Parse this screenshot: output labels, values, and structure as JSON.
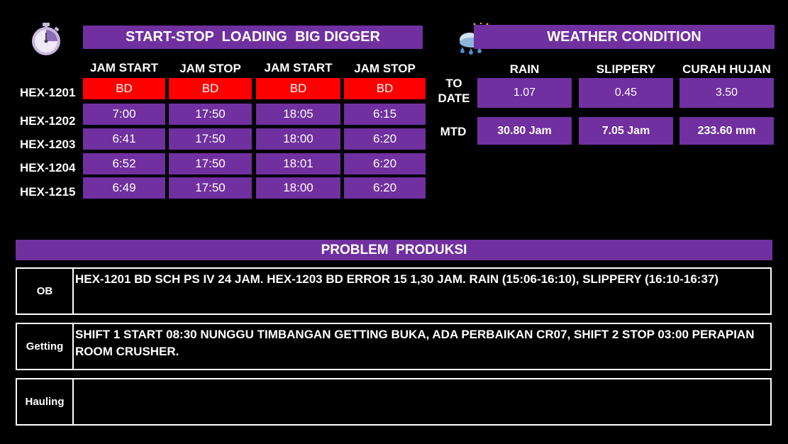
{
  "loading": {
    "title": "START-STOP  LOADING  BIG DIGGER",
    "columns": [
      "JAM START",
      "JAM STOP",
      "JAM START",
      "JAM STOP"
    ],
    "rows": [
      {
        "unit": "HEX-1201",
        "values": [
          "BD",
          "BD",
          "BD",
          "BD"
        ]
      },
      {
        "unit": "HEX-1202",
        "values": [
          "7:00",
          "17:50",
          "18:05",
          "6:15"
        ]
      },
      {
        "unit": "HEX-1203",
        "values": [
          "6:41",
          "17:50",
          "18:00",
          "6:20"
        ]
      },
      {
        "unit": "HEX-1204",
        "values": [
          "6:52",
          "17:50",
          "18:01",
          "6:20"
        ]
      },
      {
        "unit": "HEX-1215",
        "values": [
          "6:49",
          "17:50",
          "18:00",
          "6:20"
        ]
      }
    ],
    "bd_color": "#ff0000",
    "cell_color": "#7030a0"
  },
  "weather": {
    "title": "WEATHER CONDITION",
    "columns": [
      "RAIN",
      "SLIPPERY",
      "CURAH HUJAN"
    ],
    "to_date_label": "TO DATE",
    "to_date": [
      "1.07",
      "0.45",
      "3.50"
    ],
    "mtd_label": "MTD",
    "mtd": [
      "30.80 Jam",
      "7.05 Jam",
      "233.60 mm"
    ]
  },
  "problem": {
    "title": "PROBLEM  PRODUKSI",
    "items": [
      {
        "label": "OB",
        "text": "HEX-1201 BD SCH PS IV 24 JAM. HEX-1203 BD ERROR 15 1,30 JAM.  RAIN (15:06-16:10), SLIPPERY (16:10-16:37)"
      },
      {
        "label": "Getting",
        "text": "SHIFT 1 START 08:30 NUNGGU TIMBANGAN GETTING BUKA, ADA PERBAIKAN CR07, SHIFT 2 STOP 03:00 PERAPIAN ROOM CRUSHER."
      },
      {
        "label": "Hauling",
        "text": ""
      }
    ]
  },
  "icons": [
    "stopwatch-icon",
    "rain-cloud-sun-icon"
  ]
}
